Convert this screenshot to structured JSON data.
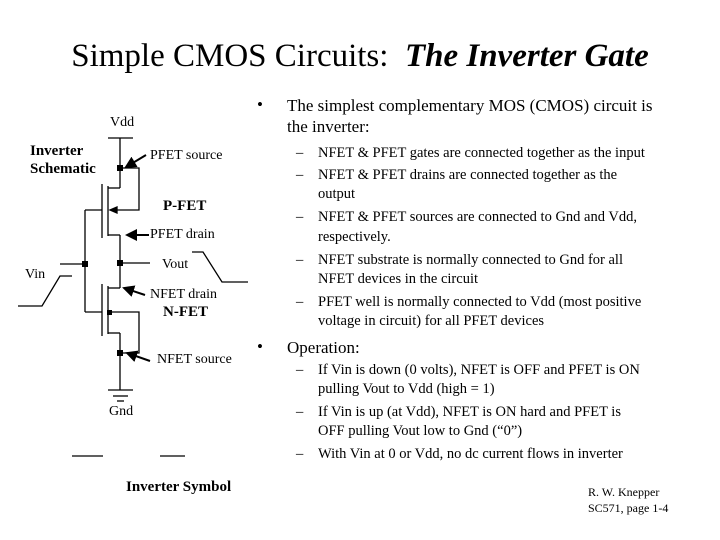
{
  "title": {
    "main": "Simple CMOS Circuits:",
    "italic": "The Inverter Gate"
  },
  "schematic": {
    "heading_line1": "Inverter",
    "heading_line2": "Schematic",
    "vdd": "Vdd",
    "gnd": "Gnd",
    "vin": "Vin",
    "vout": "Vout",
    "pfet_source": "PFET source",
    "pfet": "P-FET",
    "pfet_drain": "PFET drain",
    "nfet_drain": "NFET drain",
    "nfet": "N-FET",
    "nfet_source": "NFET source",
    "symbol_label": "Inverter Symbol"
  },
  "bullets": [
    {
      "marker": "•",
      "lines": [
        "The simplest complementary MOS (CMOS) circuit is",
        "the inverter:"
      ],
      "subitems": [
        {
          "marker": "–",
          "lines": [
            "NFET & PFET gates are connected together as the input"
          ]
        },
        {
          "marker": "–",
          "lines": [
            "NFET & PFET drains are connected together as the",
            "output"
          ]
        },
        {
          "marker": "–",
          "lines": [
            "NFET & PFET sources are connected to Gnd and Vdd,",
            "respectively."
          ]
        },
        {
          "marker": "–",
          "lines": [
            "NFET substrate is normally connected to Gnd for all",
            "NFET devices in the circuit"
          ]
        },
        {
          "marker": "–",
          "lines": [
            "PFET well is normally connected to Vdd (most positive",
            "voltage in circuit) for all PFET devices"
          ]
        }
      ]
    },
    {
      "marker": "•",
      "lines": [
        "Operation:"
      ],
      "subitems": [
        {
          "marker": "–",
          "lines": [
            "If Vin is down (0 volts), NFET is OFF and PFET is ON",
            "pulling Vout to Vdd (high = 1)"
          ]
        },
        {
          "marker": "–",
          "lines": [
            "If Vin is up (at Vdd), NFET is ON hard and PFET is",
            "OFF pulling Vout low to Gnd (“0”)"
          ]
        },
        {
          "marker": "–",
          "lines": [
            "With Vin at 0 or Vdd, no dc current flows in inverter"
          ]
        }
      ]
    }
  ],
  "footer": {
    "author": "R. W. Knepper",
    "page": "SC571,  page 1-4"
  }
}
